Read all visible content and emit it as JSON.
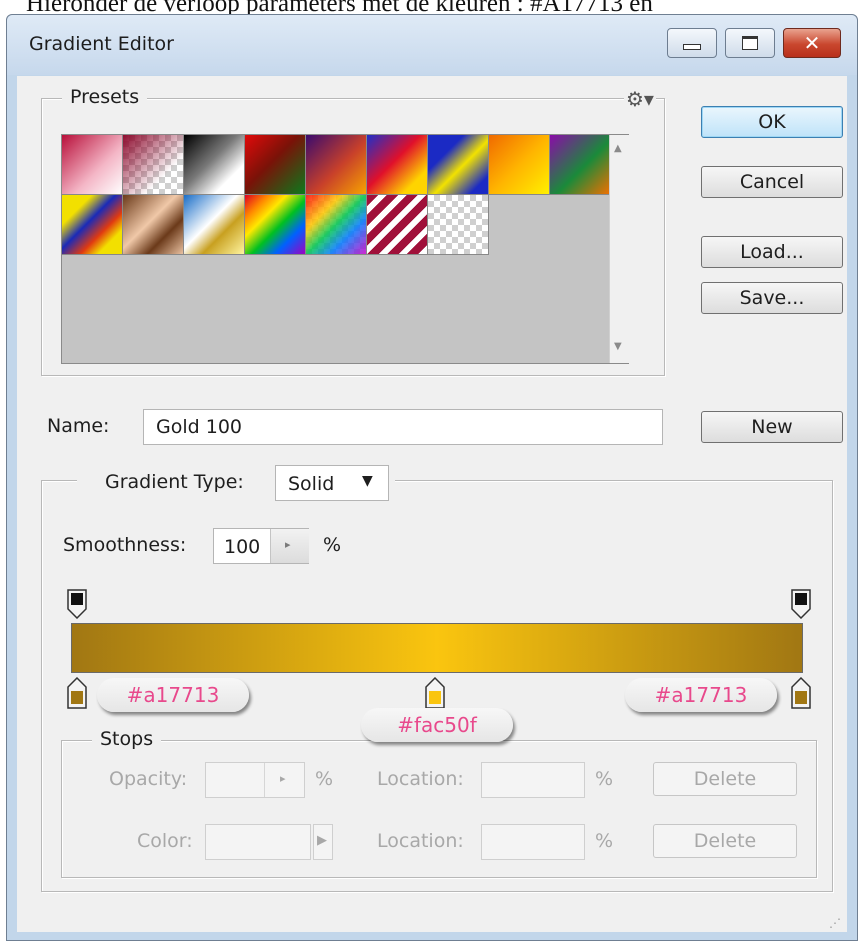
{
  "top_caption": "Hieronder de verloop parameters met de kleuren : #A17713 en",
  "window": {
    "title": "Gradient Editor",
    "controls": {
      "minimize": "minimize-icon",
      "maximize": "maximize-icon",
      "close": "close-icon"
    }
  },
  "presets": {
    "label": "Presets",
    "menu_icon": "gear-icon",
    "swatch_count": 16
  },
  "buttons": {
    "ok": "OK",
    "cancel": "Cancel",
    "load": "Load...",
    "save": "Save...",
    "new": "New"
  },
  "name": {
    "label": "Name:",
    "value": "Gold 100"
  },
  "gradient_type": {
    "label": "Gradient Type:",
    "value": "Solid"
  },
  "smoothness": {
    "label": "Smoothness:",
    "value": "100",
    "unit": "%"
  },
  "gradient": {
    "colors": [
      "#a17713",
      "#fac50f",
      "#a17713"
    ],
    "stop_labels": [
      "#a17713",
      "#fac50f",
      "#a17713"
    ]
  },
  "stops": {
    "label": "Stops",
    "opacity_label": "Opacity:",
    "color_label": "Color:",
    "location_label": "Location:",
    "percent": "%",
    "delete_label": "Delete"
  },
  "colors": {
    "accent_label": "#e8498c",
    "ok_border": "#3c7fb1"
  }
}
